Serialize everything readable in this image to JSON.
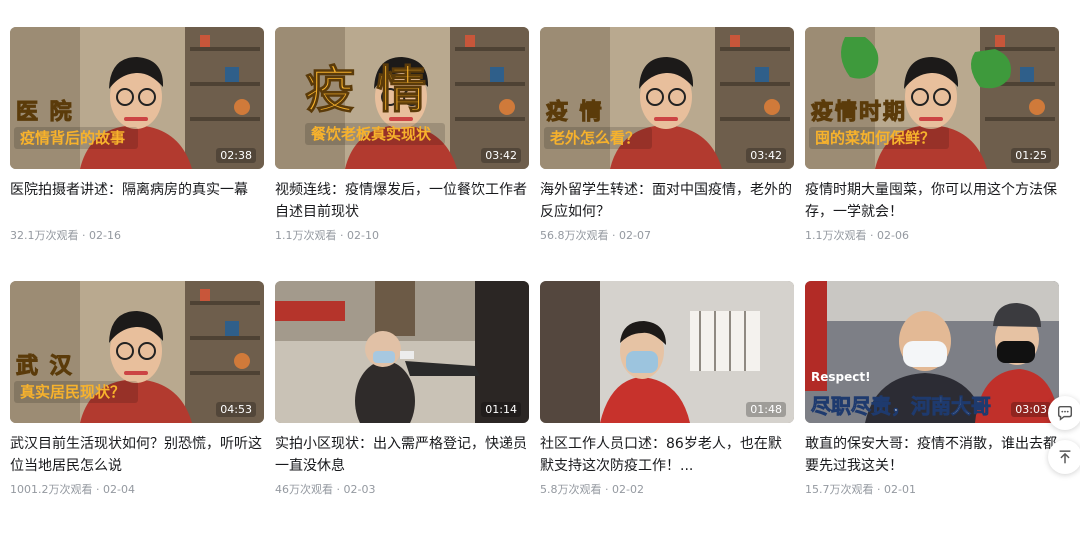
{
  "videos": [
    {
      "title": "医院拍摄者讲述：隔离病房的真实一幕",
      "views": "32.1万次观看",
      "date": "02-16",
      "duration": "02:38",
      "big_text": "医  院",
      "sub_text": "疫情背后的故事",
      "scene": "person"
    },
    {
      "title": "视频连线：疫情爆发后，一位餐饮工作者自述目前现状",
      "views": "1.1万次观看",
      "date": "02-10",
      "duration": "03:42",
      "big_text": "疫 情",
      "sub_text": "餐饮老板真实现状",
      "scene": "person"
    },
    {
      "title": "海外留学生转述：面对中国疫情，老外的反应如何？",
      "views": "56.8万次观看",
      "date": "02-07",
      "duration": "03:42",
      "big_text": "疫  情",
      "sub_text": "老外怎么看？",
      "scene": "person"
    },
    {
      "title": "疫情时期大量囤菜，你可以用这个方法保存，一学就会！",
      "views": "1.1万次观看",
      "date": "02-06",
      "duration": "01:25",
      "big_text": "疫情时期",
      "sub_text": "囤的菜如何保鲜？",
      "scene": "person-veg"
    },
    {
      "title": "武汉目前生活现状如何？别恐慌，听听这位当地居民怎么说",
      "views": "1001.2万次观看",
      "date": "02-04",
      "duration": "04:53",
      "big_text": "武  汉",
      "sub_text": "真实居民现状？",
      "scene": "person"
    },
    {
      "title": "实拍小区现状：出入需严格登记，快递员一直没休息",
      "views": "46万次观看",
      "date": "02-03",
      "duration": "01:14",
      "big_text": "",
      "sub_text": "",
      "scene": "street"
    },
    {
      "title": "社区工作人员口述：86岁老人，也在默默支持这次防疫工作！...",
      "views": "5.8万次观看",
      "date": "02-02",
      "duration": "01:48",
      "big_text": "",
      "sub_text": "",
      "scene": "worker"
    },
    {
      "title": "敢直的保安大哥：疫情不消散，谁出去都要先过我这关！",
      "views": "15.7万次观看",
      "date": "02-01",
      "duration": "03:03",
      "big_text": "尽职尽责，河南大哥",
      "sub_text": "Respect!",
      "scene": "guard"
    }
  ],
  "separator": "·",
  "colors": {
    "accent": "#f7b22c",
    "meta": "#9499a0",
    "title": "#18191c"
  },
  "side_buttons": [
    {
      "name": "comment-icon"
    },
    {
      "name": "back-to-top-icon"
    }
  ]
}
